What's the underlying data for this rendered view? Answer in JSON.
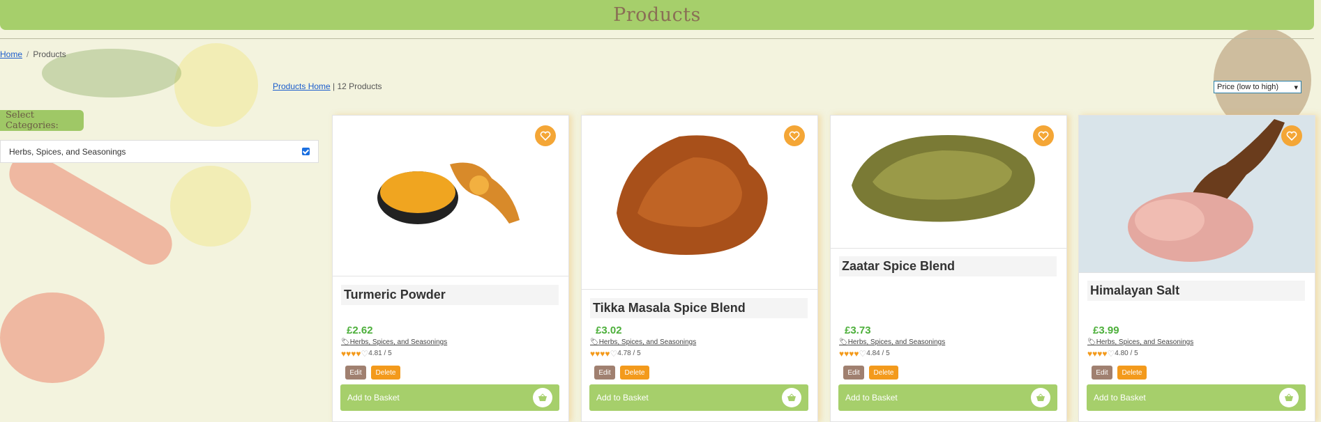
{
  "header": {
    "title": "Products"
  },
  "breadcrumb": {
    "home": "Home",
    "separator": "/",
    "current": "Products"
  },
  "listing": {
    "home_link": "Products Home",
    "count_text": "| 12 Products"
  },
  "sort": {
    "selected": "Price (low to high)"
  },
  "categories": {
    "title": "Select Categories:",
    "items": [
      {
        "label": "Herbs, Spices, and Seasonings",
        "checked": true
      }
    ]
  },
  "products": [
    {
      "name": "Turmeric Powder",
      "price": "£2.62",
      "category": "Herbs, Spices, and Seasonings",
      "rating_text": "4.81 / 5",
      "stars": 4,
      "edit": "Edit",
      "delete": "Delete",
      "basket": "Add to Basket"
    },
    {
      "name": "Tikka Masala Spice Blend",
      "price": "£3.02",
      "category": "Herbs, Spices, and Seasonings",
      "rating_text": "4.78 / 5",
      "stars": 4,
      "edit": "Edit",
      "delete": "Delete",
      "basket": "Add to Basket"
    },
    {
      "name": "Zaatar Spice Blend",
      "price": "£3.73",
      "category": "Herbs, Spices, and Seasonings",
      "rating_text": "4.84 / 5",
      "stars": 4,
      "edit": "Edit",
      "delete": "Delete",
      "basket": "Add to Basket"
    },
    {
      "name": "Himalayan Salt",
      "price": "£3.99",
      "category": "Herbs, Spices, and Seasonings",
      "rating_text": "4.80 / 5",
      "stars": 4,
      "edit": "Edit",
      "delete": "Delete",
      "basket": "Add to Basket"
    }
  ],
  "colors": {
    "accent_green": "#a6cf6b",
    "orange": "#f39a1c",
    "price_green": "#4caf3a"
  }
}
